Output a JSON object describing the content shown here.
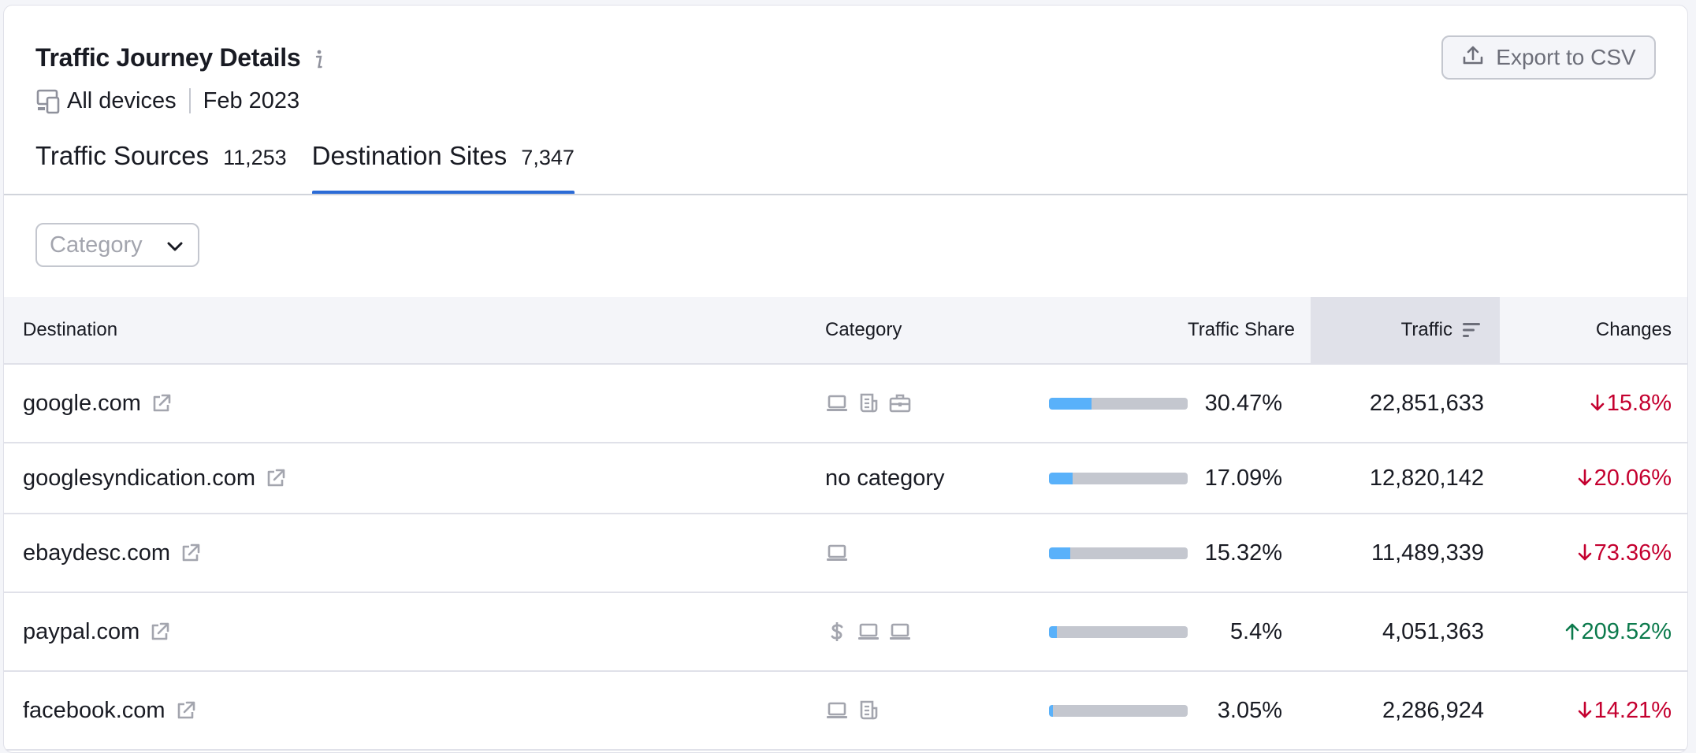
{
  "header": {
    "title": "Traffic Journey Details",
    "devices": "All devices",
    "period": "Feb 2023",
    "export_label": "Export to CSV"
  },
  "tabs": [
    {
      "label": "Traffic Sources",
      "count": "11,253",
      "active": false
    },
    {
      "label": "Destination Sites",
      "count": "7,347",
      "active": true
    }
  ],
  "filter": {
    "category_placeholder": "Category"
  },
  "table": {
    "columns": {
      "destination": "Destination",
      "category": "Category",
      "traffic_share": "Traffic Share",
      "traffic": "Traffic",
      "changes": "Changes"
    },
    "rows": [
      {
        "destination": "google.com",
        "category_icons": [
          "laptop-icon",
          "news-icon",
          "briefcase-icon"
        ],
        "category_text": "",
        "share": "30.47%",
        "share_value": 30.47,
        "traffic": "22,851,633",
        "change": "15.8%",
        "change_dir": "down"
      },
      {
        "destination": "googlesyndication.com",
        "category_icons": [],
        "category_text": "no category",
        "share": "17.09%",
        "share_value": 17.09,
        "traffic": "12,820,142",
        "change": "20.06%",
        "change_dir": "down"
      },
      {
        "destination": "ebaydesc.com",
        "category_icons": [
          "laptop-icon"
        ],
        "category_text": "",
        "share": "15.32%",
        "share_value": 15.32,
        "traffic": "11,489,339",
        "change": "73.36%",
        "change_dir": "down"
      },
      {
        "destination": "paypal.com",
        "category_icons": [
          "dollar-icon",
          "laptop-icon",
          "laptop-icon"
        ],
        "category_text": "",
        "share": "5.4%",
        "share_value": 5.4,
        "traffic": "4,051,363",
        "change": "209.52%",
        "change_dir": "up"
      },
      {
        "destination": "facebook.com",
        "category_icons": [
          "laptop-icon",
          "news-icon"
        ],
        "category_text": "",
        "share": "3.05%",
        "share_value": 3.05,
        "traffic": "2,286,924",
        "change": "14.21%",
        "change_dir": "down"
      }
    ]
  },
  "colors": {
    "accent": "#2b6bd6",
    "bar_fill": "#59b1fa",
    "negative": "#c4002f",
    "positive": "#0b7a4c"
  }
}
